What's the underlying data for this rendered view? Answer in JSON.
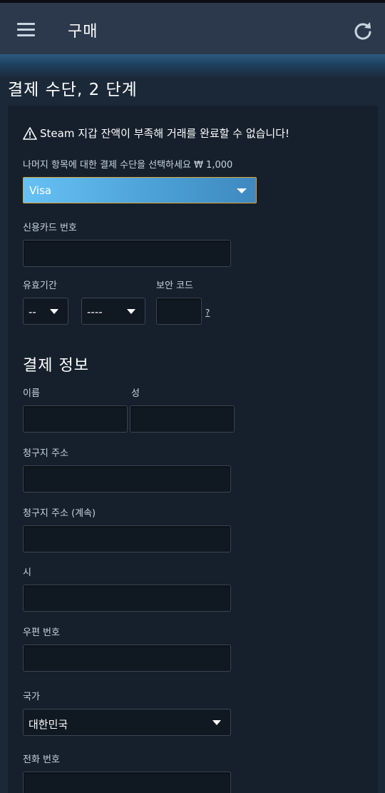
{
  "header": {
    "title": "구매",
    "menu_icon": "hamburger-menu-icon",
    "refresh_icon": "refresh-icon"
  },
  "page": {
    "step_title": "결제 수단, 2 단계"
  },
  "payment": {
    "warning": "Steam 지갑 잔액이 부족해 거래를 완료할 수 없습니다!",
    "select_prompt": "나머지 항목에 대한 결제 수단을 선택하세요 ₩ 1,000",
    "method_value": "Visa",
    "card_number_label": "신용카드 번호",
    "expiry_label": "유효기간",
    "expiry_month_value": "--",
    "expiry_year_value": "----",
    "cvv_label": "보안 코드",
    "cvv_help": "?"
  },
  "billing": {
    "section_title": "결제 정보",
    "first_name_label": "이름",
    "last_name_label": "성",
    "address_label": "청구지 주소",
    "address2_label": "청구지 주소 (계속)",
    "city_label": "시",
    "zip_label": "우편 번호",
    "country_label": "국가",
    "country_value": "대한민국",
    "phone_label": "전화 번호"
  },
  "colors": {
    "background": "#1b2838",
    "panel": "#16202d",
    "appbar": "#2c394d",
    "select_accent": "#67c1f5",
    "focus_border": "#d9a23a"
  }
}
